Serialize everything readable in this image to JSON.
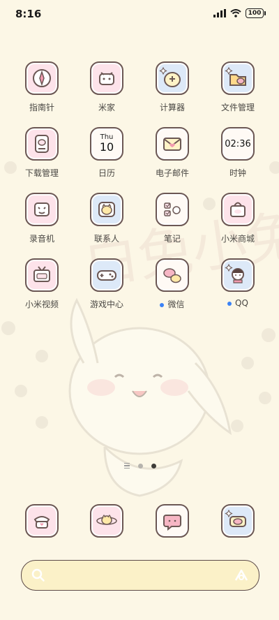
{
  "status": {
    "time": "8:16",
    "battery": "100"
  },
  "apps": [
    {
      "label": "指南针",
      "icon": "compass-icon"
    },
    {
      "label": "米家",
      "icon": "mi-home-icon"
    },
    {
      "label": "计算器",
      "icon": "calculator-icon"
    },
    {
      "label": "文件管理",
      "icon": "file-manager-icon"
    },
    {
      "label": "下载管理",
      "icon": "download-manager-icon"
    },
    {
      "label": "日历",
      "icon": "calendar-icon",
      "day": "Thu",
      "date": "10"
    },
    {
      "label": "电子邮件",
      "icon": "email-icon"
    },
    {
      "label": "时钟",
      "icon": "clock-icon",
      "time": "02:36"
    },
    {
      "label": "录音机",
      "icon": "recorder-icon"
    },
    {
      "label": "联系人",
      "icon": "contacts-icon"
    },
    {
      "label": "笔记",
      "icon": "notes-icon"
    },
    {
      "label": "小米商城",
      "icon": "mi-store-icon"
    },
    {
      "label": "小米视频",
      "icon": "mi-video-icon"
    },
    {
      "label": "游戏中心",
      "icon": "game-center-icon"
    },
    {
      "label": "微信",
      "icon": "wechat-icon",
      "badge": "new-install-dot"
    },
    {
      "label": "QQ",
      "icon": "qq-icon",
      "badge": "new-install-dot"
    }
  ],
  "dock": [
    {
      "icon": "phone-icon"
    },
    {
      "icon": "browser-icon"
    },
    {
      "icon": "messages-icon"
    },
    {
      "icon": "camera-icon"
    }
  ],
  "wallpaper_text": "白兔小兔叽",
  "colors": {
    "background": "#fcf7e6",
    "icon_pink": "#fde3ea",
    "icon_blue": "#dde9f8",
    "outline": "#6b5754",
    "badge_dot": "#3b82f6"
  }
}
